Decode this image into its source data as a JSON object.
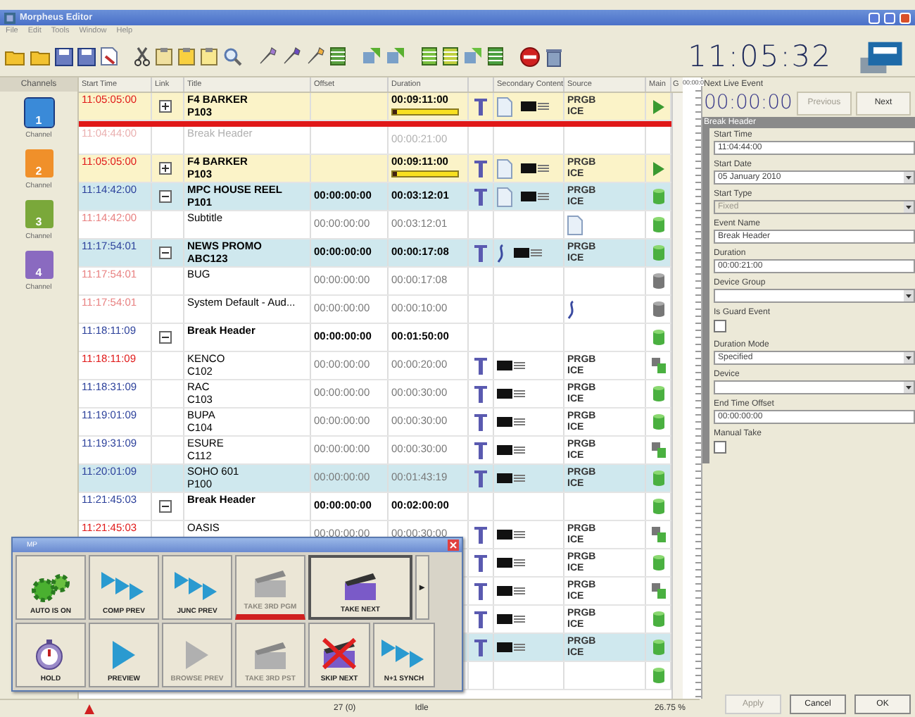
{
  "window": {
    "title": "Morpheus Editor"
  },
  "menu": [
    "File",
    "Edit",
    "Tools",
    "Window",
    "Help"
  ],
  "clock": "11:05:32",
  "channels": {
    "header": "Channels",
    "items": [
      {
        "number": "1",
        "label": "Channel",
        "color": "#3a8ad8",
        "selected": true
      },
      {
        "number": "2",
        "label": "Channel",
        "color": "#f0902a",
        "selected": false
      },
      {
        "number": "3",
        "label": "Channel",
        "color": "#7aa83a",
        "selected": false
      },
      {
        "number": "4",
        "label": "Channel",
        "color": "#8a6ac0",
        "selected": false
      }
    ]
  },
  "columns": [
    "Start Time",
    "Link",
    "Title",
    "Offset",
    "Duration",
    "Secondary Content",
    "Source",
    "Main",
    "G"
  ],
  "rows": [
    {
      "kind": "current",
      "time": "11:05:05:00",
      "color": "#e01818",
      "link": {
        "expanded": false
      },
      "title": [
        "F4 BARKER",
        "P103"
      ],
      "title_bold": true,
      "dimmed": false,
      "duration": "00:09:11:00",
      "level": 0.06,
      "playhead": true,
      "transition": true,
      "secondary": {
        "kind": "doc"
      },
      "keyer": true,
      "source": {
        "kind": "text",
        "lines": [
          "PRGB",
          "ICE"
        ]
      },
      "main": {
        "kind": "play"
      }
    },
    {
      "kind": "plain",
      "time": "11:04:44:00",
      "color": "#eab0b0",
      "title": [
        "Break Header"
      ],
      "title_bold": false,
      "dimmed": true,
      "duration": "00:00:21:00",
      "playhead": false,
      "transition": false,
      "keyer": false
    },
    {
      "kind": "current",
      "time": "11:05:05:00",
      "color": "#e01818",
      "link": {
        "expanded": false
      },
      "title": [
        "F4 BARKER",
        "P103"
      ],
      "title_bold": true,
      "dimmed": false,
      "duration": "00:09:11:00",
      "level": 0.06,
      "playhead": false,
      "transition": true,
      "secondary": {
        "kind": "doc"
      },
      "keyer": true,
      "source": {
        "kind": "text",
        "lines": [
          "PRGB",
          "ICE"
        ]
      },
      "main": {
        "kind": "play"
      }
    },
    {
      "kind": "group",
      "time": "11:14:42:00",
      "color": "#2a3f9a",
      "link": {
        "expanded": true
      },
      "title": [
        "MPC HOUSE REEL",
        "P101"
      ],
      "title_bold": true,
      "dimmed": false,
      "offset": "00:00:00:00",
      "duration": "00:03:12:01",
      "playhead": false,
      "transition": true,
      "secondary": {
        "kind": "doc"
      },
      "keyer": true,
      "source": {
        "kind": "text",
        "lines": [
          "PRGB",
          "ICE"
        ]
      },
      "main": {
        "kind": "green"
      }
    },
    {
      "kind": "plain",
      "time": "11:14:42:00",
      "color": "#e88080",
      "title": [
        "Subtitle"
      ],
      "title_bold": false,
      "dimmed": false,
      "offset": "00:00:00:00",
      "duration": "00:03:12:01",
      "playhead": false,
      "transition": false,
      "keyer": false,
      "source": {
        "kind": "doc"
      },
      "main": {
        "kind": "green"
      }
    },
    {
      "kind": "group",
      "time": "11:17:54:01",
      "color": "#2a3f9a",
      "link": {
        "expanded": true
      },
      "title": [
        "NEWS PROMO",
        "ABC123"
      ],
      "title_bold": true,
      "dimmed": false,
      "offset": "00:00:00:00",
      "duration": "00:00:17:08",
      "playhead": false,
      "transition": true,
      "secondary": {
        "kind": "hook"
      },
      "keyer": true,
      "source": {
        "kind": "text",
        "lines": [
          "PRGB",
          "ICE"
        ]
      },
      "main": {
        "kind": "green"
      }
    },
    {
      "kind": "plain",
      "time": "11:17:54:01",
      "color": "#e88080",
      "title": [
        "BUG"
      ],
      "title_bold": false,
      "dimmed": false,
      "offset": "00:00:00:00",
      "duration": "00:00:17:08",
      "playhead": false,
      "transition": false,
      "keyer": false,
      "main": {
        "kind": "grey"
      }
    },
    {
      "kind": "plain",
      "time": "11:17:54:01",
      "color": "#e88080",
      "title": [
        "System Default - Aud..."
      ],
      "title_bold": false,
      "dimmed": false,
      "offset": "00:00:00:00",
      "duration": "00:00:10:00",
      "playhead": false,
      "transition": false,
      "keyer": false,
      "source": {
        "kind": "hook"
      },
      "main": {
        "kind": "grey"
      }
    },
    {
      "kind": "plain",
      "time": "11:18:11:09",
      "color": "#2a3f9a",
      "link": {
        "expanded": true
      },
      "title": [
        "Break Header"
      ],
      "title_bold": true,
      "dimmed": false,
      "offset": "00:00:00:00",
      "duration": "00:01:50:00",
      "playhead": false,
      "transition": false,
      "keyer": false,
      "main": {
        "kind": "green"
      }
    },
    {
      "kind": "plain",
      "time": "11:18:11:09",
      "color": "#e01818",
      "title": [
        "KENCO",
        "C102"
      ],
      "title_bold": false,
      "dimmed": false,
      "offset": "00:00:00:00",
      "duration": "00:00:20:00",
      "playhead": false,
      "transition": true,
      "keyer": true,
      "source": {
        "kind": "text",
        "lines": [
          "PRGB",
          "ICE"
        ]
      },
      "main": {
        "kind": "multi"
      }
    },
    {
      "kind": "plain",
      "time": "11:18:31:09",
      "color": "#2a3f9a",
      "title": [
        "RAC",
        "C103"
      ],
      "title_bold": false,
      "dimmed": false,
      "offset": "00:00:00:00",
      "duration": "00:00:30:00",
      "playhead": false,
      "transition": true,
      "keyer": true,
      "source": {
        "kind": "text",
        "lines": [
          "PRGB",
          "ICE"
        ]
      },
      "main": {
        "kind": "green"
      }
    },
    {
      "kind": "plain",
      "time": "11:19:01:09",
      "color": "#2a3f9a",
      "title": [
        "BUPA",
        "C104"
      ],
      "title_bold": false,
      "dimmed": false,
      "offset": "00:00:00:00",
      "duration": "00:00:30:00",
      "playhead": false,
      "transition": true,
      "keyer": true,
      "source": {
        "kind": "text",
        "lines": [
          "PRGB",
          "ICE"
        ]
      },
      "main": {
        "kind": "green"
      }
    },
    {
      "kind": "plain",
      "time": "11:19:31:09",
      "color": "#2a3f9a",
      "title": [
        "ESURE",
        "C112"
      ],
      "title_bold": false,
      "dimmed": false,
      "offset": "00:00:00:00",
      "duration": "00:00:30:00",
      "playhead": false,
      "transition": true,
      "keyer": true,
      "source": {
        "kind": "text",
        "lines": [
          "PRGB",
          "ICE"
        ]
      },
      "main": {
        "kind": "multi"
      }
    },
    {
      "kind": "group",
      "time": "11:20:01:09",
      "color": "#2a3f9a",
      "title": [
        "SOHO 601",
        "P100"
      ],
      "title_bold": false,
      "dimmed": false,
      "offset": "00:00:00:00",
      "duration": "00:01:43:19",
      "playhead": false,
      "transition": true,
      "keyer": true,
      "source": {
        "kind": "text",
        "lines": [
          "PRGB",
          "ICE"
        ]
      },
      "main": {
        "kind": "green"
      }
    },
    {
      "kind": "plain",
      "time": "11:21:45:03",
      "color": "#2a3f9a",
      "link": {
        "expanded": true
      },
      "title": [
        "Break Header"
      ],
      "title_bold": true,
      "dimmed": false,
      "offset": "00:00:00:00",
      "duration": "00:02:00:00",
      "playhead": false,
      "transition": false,
      "keyer": false,
      "main": {
        "kind": "green"
      }
    },
    {
      "kind": "plain",
      "time": "11:21:45:03",
      "color": "#e01818",
      "title": [
        "OASIS"
      ],
      "title_bold": false,
      "dimmed": false,
      "offset": "00:00:00:00",
      "duration": "00:00:30:00",
      "playhead": false,
      "transition": true,
      "keyer": true,
      "source": {
        "kind": "text",
        "lines": [
          "PRGB",
          "ICE"
        ]
      },
      "main": {
        "kind": "multi"
      }
    },
    {
      "kind": "plain",
      "playhead": false,
      "transition": true,
      "keyer": true,
      "source": {
        "kind": "text",
        "lines": [
          "PRGB",
          "ICE"
        ]
      },
      "main": {
        "kind": "green"
      }
    },
    {
      "kind": "plain",
      "playhead": false,
      "transition": true,
      "keyer": true,
      "source": {
        "kind": "text",
        "lines": [
          "PRGB",
          "ICE"
        ]
      },
      "main": {
        "kind": "multi"
      }
    },
    {
      "kind": "plain",
      "playhead": false,
      "transition": true,
      "keyer": true,
      "source": {
        "kind": "text",
        "lines": [
          "PRGB",
          "ICE"
        ]
      },
      "main": {
        "kind": "green"
      }
    },
    {
      "kind": "group",
      "playhead": false,
      "transition": true,
      "keyer": true,
      "source": {
        "kind": "text",
        "lines": [
          "PRGB",
          "ICE"
        ]
      },
      "main": {
        "kind": "green"
      }
    },
    {
      "kind": "plain",
      "playhead": false,
      "transition": false,
      "keyer": false,
      "main": {
        "kind": "green"
      }
    }
  ],
  "ruler": {
    "label": "00:00:0"
  },
  "status_bar": {
    "count": "27 (0)",
    "state": "Idle",
    "percent": "26.75 %"
  },
  "panel": {
    "next_label": "Next Live Event",
    "next_time": "00:00:00",
    "nav": [
      {
        "label": "Previous",
        "disabled": true
      },
      {
        "label": "Next",
        "disabled": false
      }
    ],
    "section": "Break Header",
    "fields": [
      {
        "label": "Start Time",
        "kind": "text",
        "value": "11:04:44:00",
        "disabled": false
      },
      {
        "label": "Start Date",
        "kind": "dropdown",
        "value": "05  January  2010",
        "disabled": false
      },
      {
        "label": "Start Type",
        "kind": "dropdown",
        "value": "Fixed",
        "disabled": true
      },
      {
        "label": "Event Name",
        "kind": "text",
        "value": "Break Header",
        "disabled": false
      },
      {
        "label": "Duration",
        "kind": "text",
        "value": "00:00:21:00",
        "disabled": false
      },
      {
        "label": "Device Group",
        "kind": "dropdown",
        "disabled": false
      },
      {
        "label": "Is Guard Event",
        "kind": "checkbox",
        "checked": false,
        "disabled": false
      },
      {
        "label": "Duration Mode",
        "kind": "dropdown",
        "value": "Specified",
        "disabled": false
      },
      {
        "label": "Device",
        "kind": "dropdown",
        "disabled": false
      },
      {
        "label": "End Time Offset",
        "kind": "text",
        "value": "00:00:00:00",
        "disabled": false
      },
      {
        "label": "Manual Take",
        "kind": "checkbox",
        "checked": false,
        "disabled": false
      }
    ],
    "buttons": [
      {
        "label": "Apply",
        "disabled": true
      },
      {
        "label": "Cancel",
        "disabled": false
      },
      {
        "label": "OK",
        "disabled": false
      }
    ]
  },
  "popup": {
    "title": "MP",
    "more": "▸",
    "rows": [
      [
        {
          "label": "AUTO IS ON",
          "kind": "gears",
          "disabled": false,
          "selected": false,
          "on_air": false
        },
        {
          "label": "COMP PREV",
          "kind": "triple",
          "disabled": false,
          "selected": false,
          "on_air": false
        },
        {
          "label": "JUNC PREV",
          "kind": "triple",
          "disabled": false,
          "selected": false,
          "on_air": false
        },
        {
          "label": "TAKE 3RD PGM",
          "kind": "clapper",
          "disabled": true,
          "selected": false,
          "on_air": true
        },
        {
          "label": "TAKE NEXT",
          "kind": "clapper",
          "disabled": false,
          "selected": true,
          "on_air": false
        }
      ],
      [
        {
          "label": "HOLD",
          "kind": "stopwatch",
          "disabled": false,
          "selected": false,
          "on_air": false
        },
        {
          "label": "PREVIEW",
          "kind": "arrow",
          "disabled": false,
          "selected": false,
          "on_air": false
        },
        {
          "label": "BROWSE PREV",
          "kind": "arrow",
          "disabled": true,
          "selected": false,
          "on_air": false
        },
        {
          "label": "TAKE 3RD PST",
          "kind": "clapper",
          "disabled": true,
          "selected": false,
          "on_air": false
        },
        {
          "label": "SKIP NEXT",
          "kind": "crossed",
          "disabled": false,
          "selected": false,
          "on_air": false
        },
        {
          "label": "N+1 SYNCH",
          "kind": "triple",
          "disabled": false,
          "selected": false,
          "on_air": false
        }
      ]
    ]
  }
}
